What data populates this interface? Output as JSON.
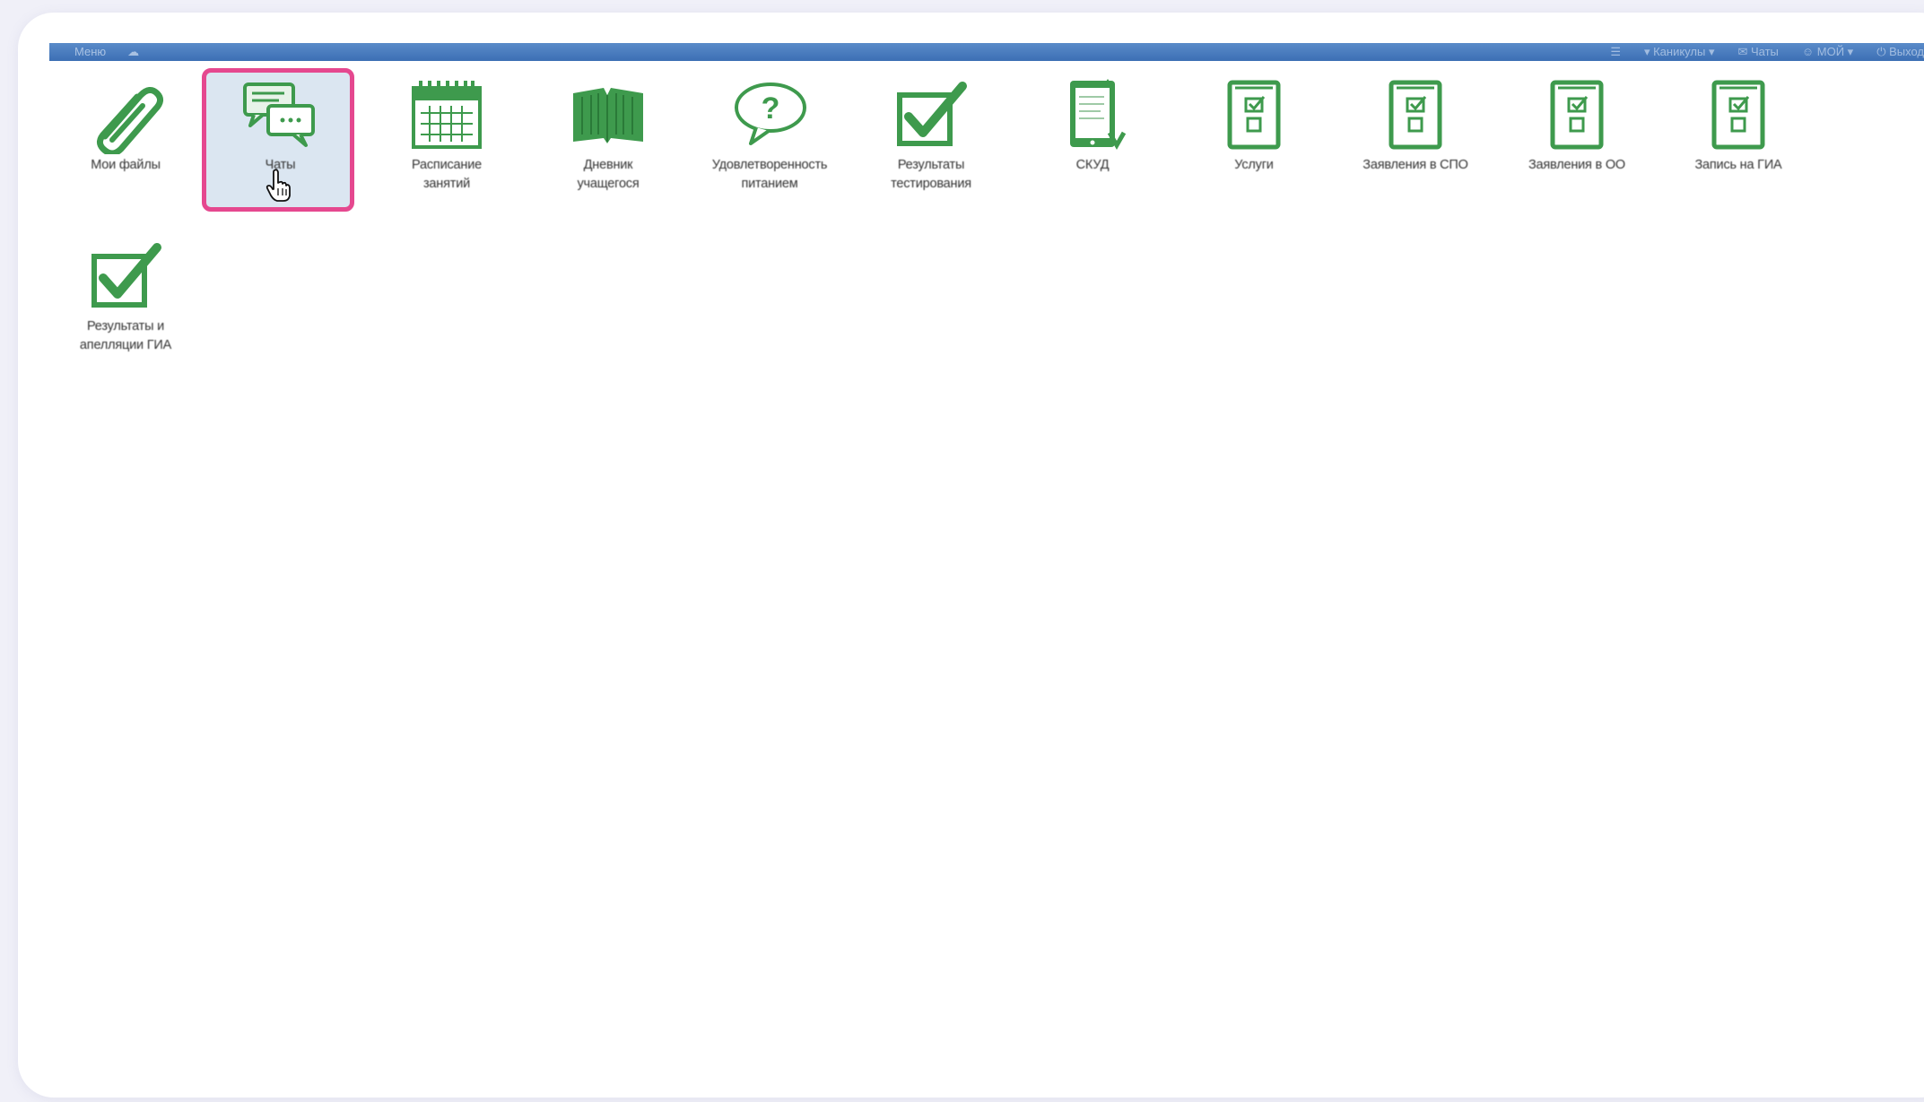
{
  "topbar": {
    "left_items": [
      "Меню",
      "☁"
    ],
    "right_items": [
      "☰",
      "▾ Каникулы ▾",
      "✉ Чаты",
      "☺ МОЙ ▾",
      "⏻ Выход"
    ]
  },
  "tiles": [
    {
      "label": "Мои файлы",
      "icon": "paperclip-icon",
      "active": false
    },
    {
      "label": "Чаты",
      "icon": "chat-icon",
      "active": true
    },
    {
      "label": "Расписание\nзанятий",
      "icon": "calendar-icon",
      "active": false
    },
    {
      "label": "Дневник\nучащегося",
      "icon": "book-icon",
      "active": false
    },
    {
      "label": "Удовлетворенность\nпитанием",
      "icon": "question-bubble-icon",
      "active": false
    },
    {
      "label": "Результаты\nтестирования",
      "icon": "checkbox-icon",
      "active": false
    },
    {
      "label": "СКУД",
      "icon": "document-card-icon",
      "active": false
    },
    {
      "label": "Услуги",
      "icon": "form-document-icon",
      "active": false
    },
    {
      "label": "Заявления в СПО",
      "icon": "form-document-icon",
      "active": false
    },
    {
      "label": "Заявления в ОО",
      "icon": "form-document-icon",
      "active": false
    },
    {
      "label": "Запись на ГИА",
      "icon": "form-document-icon",
      "active": false
    },
    {
      "label": "Результаты и\nапелляции ГИА",
      "icon": "checkbox-icon",
      "active": false
    }
  ],
  "colors": {
    "icon_green": "#3e9a4d",
    "highlight_border": "#e5488f",
    "highlight_fill": "#dbe6f1",
    "topbar_blue": "#4a7fc0"
  }
}
